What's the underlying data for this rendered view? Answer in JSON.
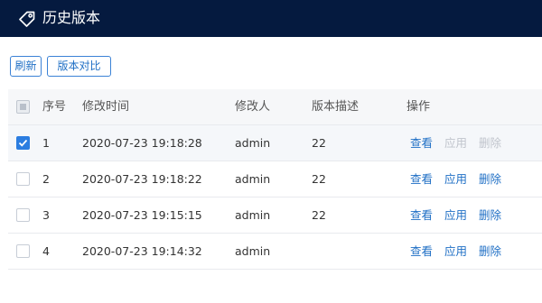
{
  "header": {
    "title": "历史版本",
    "icon": "tag-icon"
  },
  "toolbar": {
    "refresh_label": "刷新",
    "compare_label": "版本对比"
  },
  "table": {
    "columns": [
      "序号",
      "修改时间",
      "修改人",
      "版本描述",
      "操作"
    ],
    "rows": [
      {
        "index": "1",
        "time": "2020-07-23 19:18:28",
        "user": "admin",
        "desc": "22",
        "checked": true,
        "ops": {
          "view": "查看",
          "apply": "应用",
          "delete": "删除",
          "apply_disabled": true,
          "delete_disabled": true
        }
      },
      {
        "index": "2",
        "time": "2020-07-23 19:18:22",
        "user": "admin",
        "desc": "22",
        "checked": false,
        "ops": {
          "view": "查看",
          "apply": "应用",
          "delete": "删除",
          "apply_disabled": false,
          "delete_disabled": false
        }
      },
      {
        "index": "3",
        "time": "2020-07-23 19:15:15",
        "user": "admin",
        "desc": "22",
        "checked": false,
        "ops": {
          "view": "查看",
          "apply": "应用",
          "delete": "删除",
          "apply_disabled": false,
          "delete_disabled": false
        }
      },
      {
        "index": "4",
        "time": "2020-07-23 19:14:32",
        "user": "admin",
        "desc": "",
        "checked": false,
        "ops": {
          "view": "查看",
          "apply": "应用",
          "delete": "删除",
          "apply_disabled": false,
          "delete_disabled": false
        }
      }
    ]
  },
  "colors": {
    "header_bg": "#051a3f",
    "accent": "#1f6fc5",
    "disabled": "#c0c4cc",
    "checkbox_checked": "#2b7de0"
  }
}
